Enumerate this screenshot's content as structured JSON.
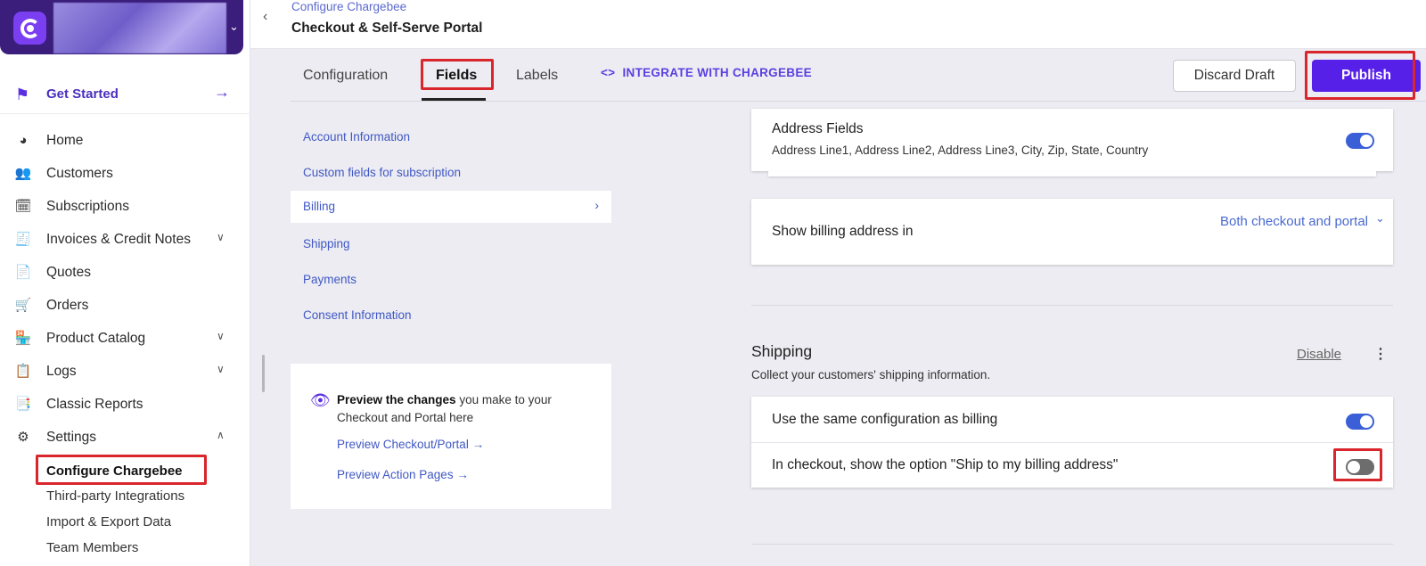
{
  "sidebar": {
    "get_started": "Get Started",
    "nav": [
      {
        "label": "Home",
        "icon": "dashboard-icon"
      },
      {
        "label": "Customers",
        "icon": "customers-icon"
      },
      {
        "label": "Subscriptions",
        "icon": "subscriptions-icon"
      },
      {
        "label": "Invoices & Credit Notes",
        "icon": "invoice-icon",
        "expandable": true
      },
      {
        "label": "Quotes",
        "icon": "quotes-icon"
      },
      {
        "label": "Orders",
        "icon": "cart-icon"
      },
      {
        "label": "Product Catalog",
        "icon": "catalog-icon",
        "expandable": true
      },
      {
        "label": "Logs",
        "icon": "logs-icon",
        "expandable": true
      },
      {
        "label": "Classic Reports",
        "icon": "reports-icon"
      },
      {
        "label": "Settings",
        "icon": "gear-icon",
        "expanded": true
      }
    ],
    "settings_sub": [
      {
        "label": "Configure Chargebee",
        "active": true
      },
      {
        "label": "Third-party Integrations"
      },
      {
        "label": "Import & Export Data"
      },
      {
        "label": "Team Members"
      }
    ]
  },
  "header": {
    "breadcrumb": "Configure Chargebee",
    "title": "Checkout & Self-Serve Portal"
  },
  "tabs": {
    "items": [
      "Configuration",
      "Fields",
      "Labels"
    ],
    "active": "Fields",
    "integrate": "INTEGRATE WITH CHARGEBEE",
    "discard": "Discard Draft",
    "publish": "Publish"
  },
  "field_nav": [
    "Account Information",
    "Custom fields for subscription",
    "Billing",
    "Shipping",
    "Payments",
    "Consent Information"
  ],
  "field_nav_active": "Billing",
  "preview": {
    "bold": "Preview the changes",
    "rest": " you make to your Checkout and Portal here",
    "link1": "Preview Checkout/Portal →",
    "link2": "Preview Action Pages →"
  },
  "billing": {
    "address_title": "Address Fields",
    "address_sub": "Address Line1, Address Line2, Address Line3, City, Zip, State, Country",
    "address_toggle": true,
    "show_in_label": "Show billing address in",
    "show_in_value": "Both checkout and portal"
  },
  "shipping": {
    "title": "Shipping",
    "desc": "Collect your customers' shipping information.",
    "disable": "Disable",
    "same_config_label": "Use the same configuration as billing",
    "same_config_toggle": true,
    "ship_to_billing_label": "In checkout, show the option \"Ship to my billing address\"",
    "ship_to_billing_toggle": false
  },
  "colors": {
    "brand": "#3b1e7c",
    "accent": "#5720e8",
    "link": "#4058c4",
    "highlight": "#d9262c",
    "toggle_on": "#3a5fd6"
  }
}
